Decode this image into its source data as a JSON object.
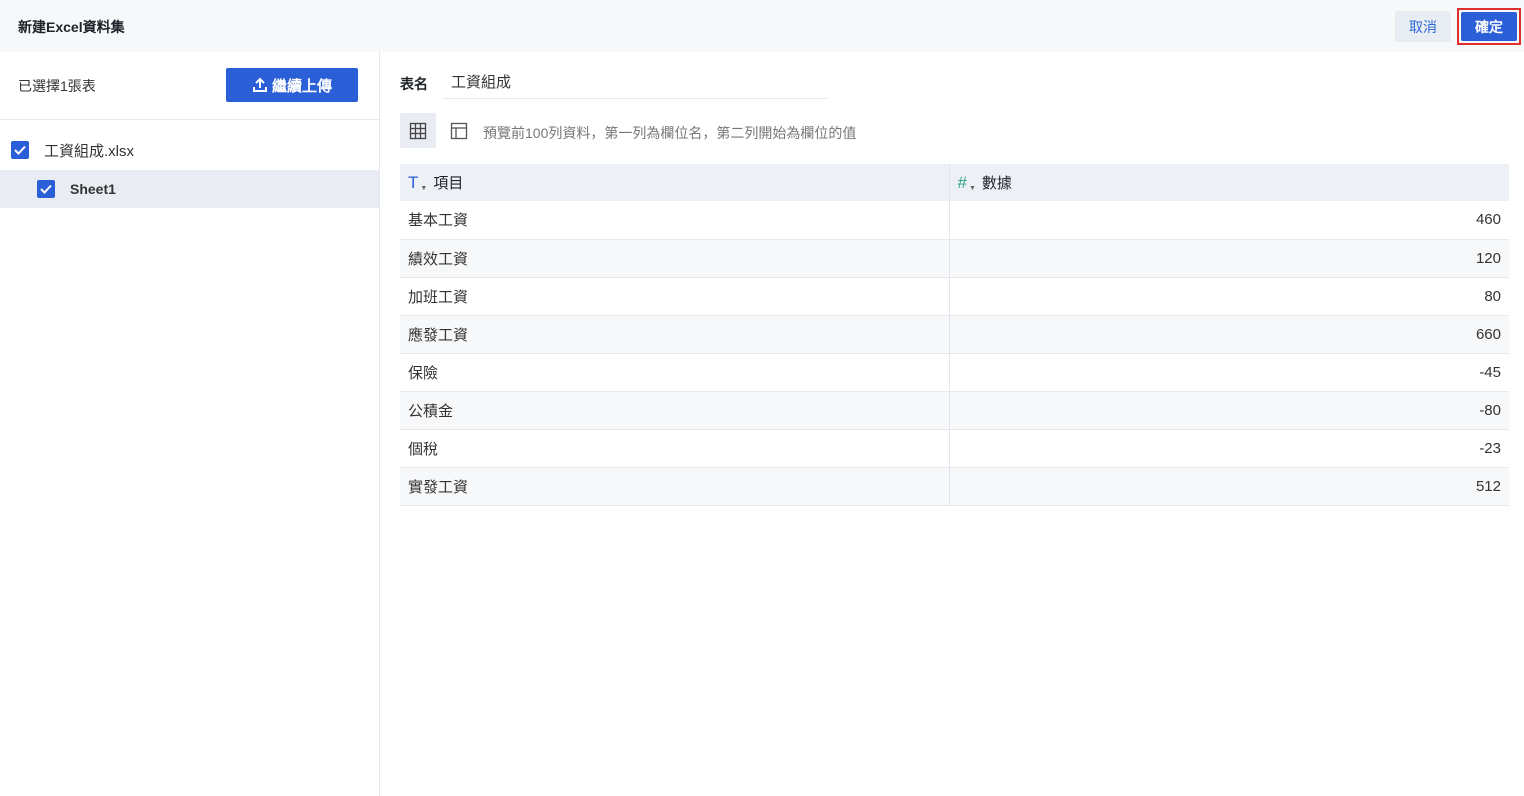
{
  "header": {
    "title": "新建Excel資料集",
    "cancel_label": "取消",
    "confirm_label": "確定"
  },
  "left": {
    "selected_info": "已選擇1張表",
    "upload_label": "繼續上傳",
    "file": {
      "name": "工資組成.xlsx",
      "checked": true
    },
    "sheets": [
      {
        "name": "Sheet1",
        "checked": true
      }
    ]
  },
  "right": {
    "table_name_label": "表名",
    "table_name_value": "工資組成",
    "hint": "預覽前100列資料，第一列為欄位名，第二列開始為欄位的值",
    "columns": [
      {
        "name": "項目",
        "type": "text",
        "type_glyph": "T"
      },
      {
        "name": "數據",
        "type": "number",
        "type_glyph": "#"
      }
    ],
    "rows": [
      [
        "基本工資",
        "460"
      ],
      [
        "績效工資",
        "120"
      ],
      [
        "加班工資",
        "80"
      ],
      [
        "應發工資",
        "660"
      ],
      [
        "保險",
        "-45"
      ],
      [
        "公積金",
        "-80"
      ],
      [
        "個稅",
        "-23"
      ],
      [
        "實發工資",
        "512"
      ]
    ]
  },
  "colors": {
    "primary": "#2a5fd7",
    "highlight_border": "#e02f2f",
    "number_type": "#2ea389"
  }
}
